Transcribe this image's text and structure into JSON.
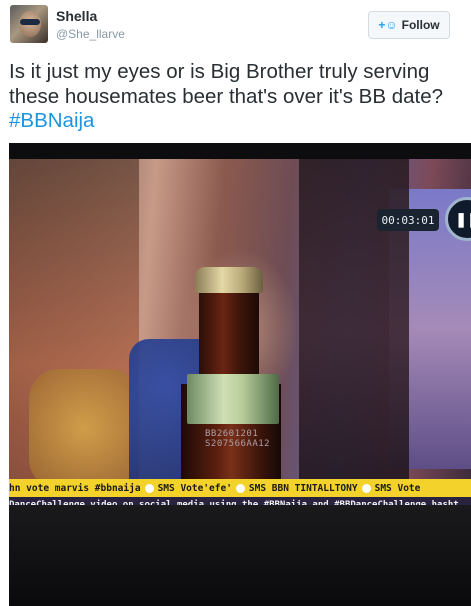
{
  "user": {
    "name": "Shella",
    "handle": "@She_llarve"
  },
  "follow_button": {
    "icon": "add-user-icon",
    "label": "Follow"
  },
  "tweet": {
    "text": "Is it just my eyes or is Big Brother truly serving these housemates beer that's over it's BB date? ",
    "hashtag": "#BBNaija"
  },
  "photo": {
    "timer": "00:03:01",
    "pause_icon": "pause-icon",
    "bottle_stamp": "BB2601201\nS207566AA12",
    "ticker_top": [
      "hn vote marvis #bbnaija",
      "SMS Vote'efe'",
      "SMS BBN TINTALLTONY",
      "SMS Vote"
    ],
    "ticker_bottom": "DanceChallenge video on social media using the #BBNaija and #BBDanceChallenge hasht"
  },
  "colors": {
    "link": "#1b95e0",
    "ticker_yellow": "#f4d22c",
    "ticker_dark": "#2a2340"
  }
}
